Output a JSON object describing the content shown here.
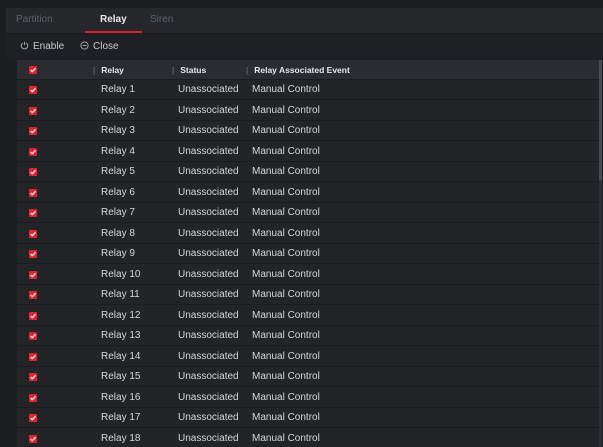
{
  "tabs": [
    {
      "label": "Partition",
      "active": false
    },
    {
      "label": "Relay",
      "active": true
    },
    {
      "label": "Siren",
      "active": false
    }
  ],
  "toolbar": {
    "enable_label": "Enable",
    "close_label": "Close"
  },
  "table": {
    "headers": {
      "relay": "Relay",
      "status": "Status",
      "event": "Relay Associated Event"
    },
    "rows": [
      {
        "relay": "Relay 1",
        "status": "Unassociated",
        "event": "Manual Control",
        "checked": true
      },
      {
        "relay": "Relay 2",
        "status": "Unassociated",
        "event": "Manual Control",
        "checked": true
      },
      {
        "relay": "Relay 3",
        "status": "Unassociated",
        "event": "Manual Control",
        "checked": true
      },
      {
        "relay": "Relay 4",
        "status": "Unassociated",
        "event": "Manual Control",
        "checked": true
      },
      {
        "relay": "Relay 5",
        "status": "Unassociated",
        "event": "Manual Control",
        "checked": true
      },
      {
        "relay": "Relay 6",
        "status": "Unassociated",
        "event": "Manual Control",
        "checked": true
      },
      {
        "relay": "Relay 7",
        "status": "Unassociated",
        "event": "Manual Control",
        "checked": true
      },
      {
        "relay": "Relay 8",
        "status": "Unassociated",
        "event": "Manual Control",
        "checked": true
      },
      {
        "relay": "Relay 9",
        "status": "Unassociated",
        "event": "Manual Control",
        "checked": true
      },
      {
        "relay": "Relay 10",
        "status": "Unassociated",
        "event": "Manual Control",
        "checked": true
      },
      {
        "relay": "Relay 11",
        "status": "Unassociated",
        "event": "Manual Control",
        "checked": true
      },
      {
        "relay": "Relay 12",
        "status": "Unassociated",
        "event": "Manual Control",
        "checked": true
      },
      {
        "relay": "Relay 13",
        "status": "Unassociated",
        "event": "Manual Control",
        "checked": true
      },
      {
        "relay": "Relay 14",
        "status": "Unassociated",
        "event": "Manual Control",
        "checked": true
      },
      {
        "relay": "Relay 15",
        "status": "Unassociated",
        "event": "Manual Control",
        "checked": true
      },
      {
        "relay": "Relay 16",
        "status": "Unassociated",
        "event": "Manual Control",
        "checked": true
      },
      {
        "relay": "Relay 17",
        "status": "Unassociated",
        "event": "Manual Control",
        "checked": true
      },
      {
        "relay": "Relay 18",
        "status": "Unassociated",
        "event": "Manual Control",
        "checked": true
      }
    ]
  },
  "colors": {
    "accent": "#d9232d",
    "checkbox": "#e0242f",
    "background": "#1c1d21"
  },
  "icons": {
    "enable": "power-icon",
    "close": "minus-circle-icon"
  }
}
